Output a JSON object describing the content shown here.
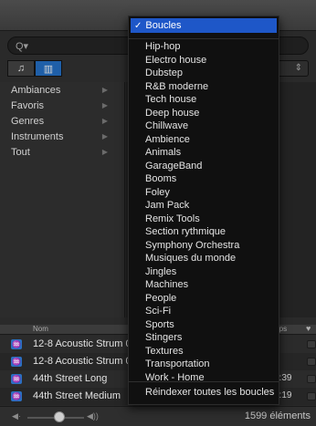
{
  "dropdown": {
    "selected_label": "Boucles",
    "check_glyph": "✓",
    "items": [
      "Hip-hop",
      "Electro house",
      "Dubstep",
      "R&B moderne",
      "Tech house",
      "Deep house",
      "Chillwave",
      "Ambience",
      "Animals",
      "GarageBand",
      "Booms",
      "Foley",
      "Jam Pack",
      "Remix Tools",
      "Section rythmique",
      "Symphony Orchestra",
      "Musiques du monde",
      "Jingles",
      "Machines",
      "People",
      "Sci-Fi",
      "Sports",
      "Stingers",
      "Textures",
      "Transportation",
      "Work - Home"
    ],
    "footer_label": "Réindexer toutes les boucles"
  },
  "search": {
    "icon": "search-icon",
    "glyph": "Q▾"
  },
  "view_buttons": [
    {
      "icon": "music-note-icon",
      "glyph": "♫"
    },
    {
      "icon": "columns-icon",
      "glyph": "▥"
    }
  ],
  "sidebar": {
    "items": [
      {
        "label": "Ambiances"
      },
      {
        "label": "Favoris"
      },
      {
        "label": "Genres"
      },
      {
        "label": "Instruments"
      },
      {
        "label": "Tout"
      }
    ],
    "arrow_glyph": "▶"
  },
  "list": {
    "headers": {
      "name": "Nom",
      "time": "mps",
      "fav_glyph": "♥"
    },
    "rows": [
      {
        "name": "12-8 Acoustic Strum 0",
        "time": ""
      },
      {
        "name": "12-8 Acoustic Strum 0",
        "time": ""
      },
      {
        "name": "44th Street Long",
        "time": "0:39"
      },
      {
        "name": "44th Street Medium",
        "time": "0:19"
      }
    ]
  },
  "status": {
    "count": "1599 éléments",
    "vol_low_glyph": "◀·",
    "vol_high_glyph": "◀))",
    "volume_level": 0.5
  },
  "colors": {
    "accent": "#1e57c8",
    "loop_icon": "#2c6fc2"
  }
}
